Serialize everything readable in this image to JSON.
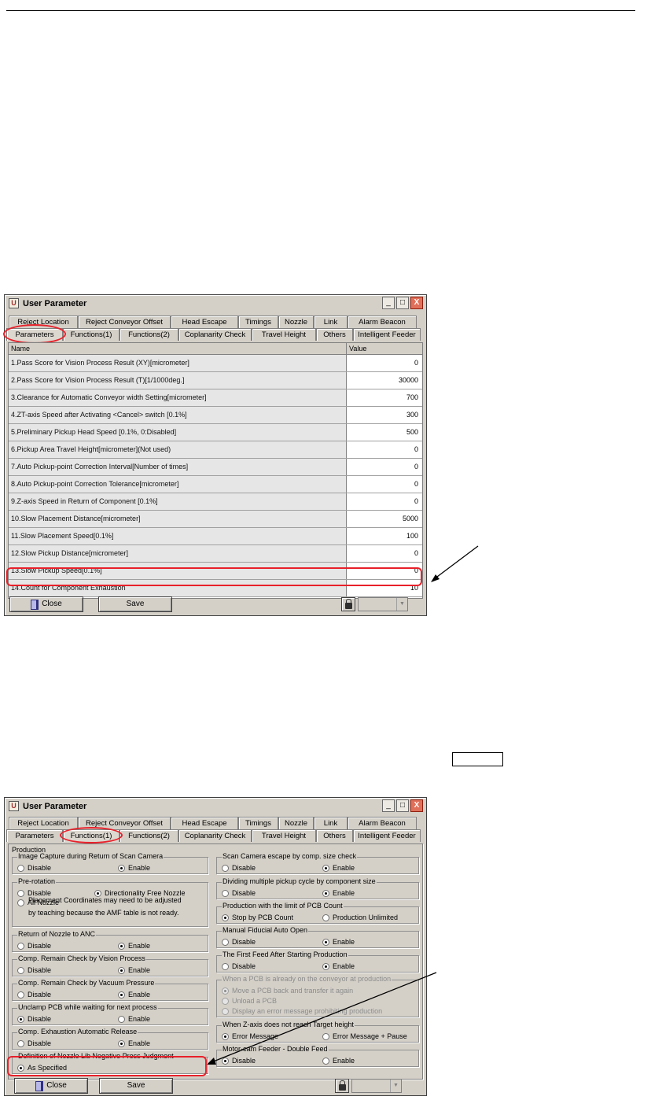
{
  "window_title": "User Parameter",
  "title_buttons": {
    "minimize": "_",
    "maximize": "□",
    "close": "X"
  },
  "app_icon_glyph": "U",
  "tabs_top": [
    "Reject Location",
    "Reject Conveyor Offset",
    "Head Escape",
    "Timings",
    "Nozzle",
    "Link",
    "Alarm Beacon"
  ],
  "tabs_bottom": [
    "Parameters",
    "Functions(1)",
    "Functions(2)",
    "Coplanarity Check",
    "Travel Height",
    "Others",
    "Intelligent Feeder"
  ],
  "params": {
    "col_name": "Name",
    "col_value": "Value",
    "rows": [
      {
        "name": "1.Pass Score for Vision Process Result (XY)[micrometer]",
        "value": "0"
      },
      {
        "name": "2.Pass Score for Vision Process Result (T)[1/1000deg.]",
        "value": "30000"
      },
      {
        "name": "3.Clearance for Automatic Conveyor width Setting[micrometer]",
        "value": "700"
      },
      {
        "name": "4.ZT-axis Speed after Activating <Cancel> switch [0.1%]",
        "value": "300"
      },
      {
        "name": "5.Preliminary Pickup Head Speed [0.1%, 0:Disabled]",
        "value": "500"
      },
      {
        "name": "6.Pickup Area Travel Height[micrometer](Not used)",
        "value": "0"
      },
      {
        "name": "7.Auto Pickup-point Correction Interval[Number of times]",
        "value": "0"
      },
      {
        "name": "8.Auto Pickup-point Correction Tolerance[micrometer]",
        "value": "0"
      },
      {
        "name": "9.Z-axis Speed in Return of Component [0.1%]",
        "value": "0"
      },
      {
        "name": "10.Slow Placement Distance[micrometer]",
        "value": "5000"
      },
      {
        "name": "11.Slow Placement Speed[0.1%]",
        "value": "100"
      },
      {
        "name": "12.Slow Pickup Distance[micrometer]",
        "value": "0"
      },
      {
        "name": "13.Slow Pickup Speed[0.1%]",
        "value": "0"
      },
      {
        "name": "14.Count for Component Exhaustion",
        "value": "10"
      }
    ]
  },
  "buttons": {
    "close": "Close",
    "save": "Save"
  },
  "functions1": {
    "production_label": "Production",
    "left_groups": [
      {
        "title": "Image Capture during Return of Scan Camera",
        "options": [
          {
            "label": "Disable",
            "checked": false
          },
          {
            "label": "Enable",
            "checked": true
          }
        ]
      },
      {
        "title": "Pre-rotation",
        "options": [
          {
            "label": "Disable",
            "checked": false
          },
          {
            "label": "Directionality Free Nozzle",
            "checked": true
          },
          {
            "label": "All Nozzle",
            "checked": false
          }
        ],
        "note": [
          "Placement Coordinates may need to be adjusted",
          "by teaching because the AMF table is not ready."
        ]
      },
      {
        "title": "Return of Nozzle to ANC",
        "options": [
          {
            "label": "Disable",
            "checked": false
          },
          {
            "label": "Enable",
            "checked": true
          }
        ]
      },
      {
        "title": "Comp. Remain Check by Vision Process",
        "options": [
          {
            "label": "Disable",
            "checked": false
          },
          {
            "label": "Enable",
            "checked": true
          }
        ]
      },
      {
        "title": "Comp. Remain Check by Vacuum Pressure",
        "options": [
          {
            "label": "Disable",
            "checked": false
          },
          {
            "label": "Enable",
            "checked": true
          }
        ]
      },
      {
        "title": "Unclamp PCB while waiting for next process",
        "options": [
          {
            "label": "Disable",
            "checked": true
          },
          {
            "label": "Enable",
            "checked": false
          }
        ]
      },
      {
        "title": "Comp. Exhaustion Automatic Release",
        "options": [
          {
            "label": "Disable",
            "checked": false
          },
          {
            "label": "Enable",
            "checked": true
          }
        ]
      },
      {
        "title": "Definition of Nozzle Lib Negative Press Judgment",
        "options": [
          {
            "label": "As Specified",
            "checked": true
          }
        ]
      }
    ],
    "right_groups": [
      {
        "title": "Scan Camera escape by comp. size check",
        "options": [
          {
            "label": "Disable",
            "checked": false
          },
          {
            "label": "Enable",
            "checked": true
          }
        ]
      },
      {
        "title": "Dividing multiple pickup cycle by component size",
        "options": [
          {
            "label": "Disable",
            "checked": false
          },
          {
            "label": "Enable",
            "checked": true
          }
        ]
      },
      {
        "title": "Production with the limit of PCB Count",
        "options": [
          {
            "label": "Stop by PCB Count",
            "checked": true
          },
          {
            "label": "Production Unlimited",
            "checked": false
          }
        ]
      },
      {
        "title": "Manual Fiducial Auto Open",
        "options": [
          {
            "label": "Disable",
            "checked": false
          },
          {
            "label": "Enable",
            "checked": true
          }
        ]
      },
      {
        "title": "The First Feed After Starting Production",
        "options": [
          {
            "label": "Disable",
            "checked": false
          },
          {
            "label": "Enable",
            "checked": true
          }
        ]
      },
      {
        "title": "When a PCB is already on the conveyor at production",
        "disabled": true,
        "options": [
          {
            "label": "Move a PCB back and transfer it again",
            "checked": true
          },
          {
            "label": "Unload a PCB",
            "checked": false
          },
          {
            "label": "Display an error message prohibiting production",
            "checked": false
          }
        ]
      },
      {
        "title": "When Z-axis does not reach Target height",
        "options": [
          {
            "label": "Error Message",
            "checked": true
          },
          {
            "label": "Error Message + Pause",
            "checked": false
          }
        ]
      },
      {
        "title": "Motor-cam Feeder - Double Feed",
        "options": [
          {
            "label": "Disable",
            "checked": true
          },
          {
            "label": "Enable",
            "checked": false
          }
        ]
      }
    ]
  },
  "colors": {
    "window_bg": "#d4d0c8",
    "highlight": "#e8202a",
    "grid_name_bg": "#e6e6e6"
  }
}
